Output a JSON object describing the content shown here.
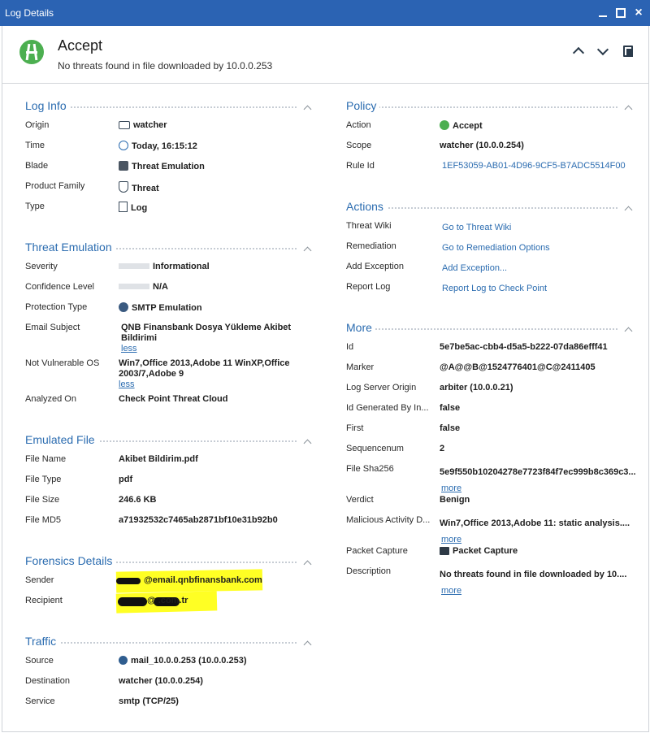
{
  "window": {
    "title": "Log Details",
    "close_glyph": "×",
    "controls": [
      "minimize-icon",
      "maximize-icon",
      "close-icon"
    ]
  },
  "header": {
    "title": "Accept",
    "subtitle": "No threats found in file downloaded by 10.0.0.253",
    "accent": "#4caf50"
  },
  "log_info": {
    "title": "Log Info",
    "rows": [
      {
        "label": "Origin",
        "value": "watcher",
        "icon": "watcher-icon"
      },
      {
        "label": "Time",
        "value": "Today, 16:15:12",
        "icon": "clock-icon"
      },
      {
        "label": "Blade",
        "value": "Threat Emulation",
        "icon": "blade-icon"
      },
      {
        "label": "Product Family",
        "value": "Threat",
        "icon": "shield-icon"
      },
      {
        "label": "Type",
        "value": "Log",
        "icon": "log-icon"
      }
    ]
  },
  "threat_emulation": {
    "title": "Threat Emulation",
    "severity_label": "Severity",
    "severity": "Informational",
    "confidence_label": "Confidence Level",
    "confidence": "N/A",
    "protection_label": "Protection Type",
    "protection": "SMTP Emulation",
    "subject_label": "Email Subject",
    "subject": "QNB Finansbank Dosya Yükleme Akibet Bildirimi",
    "less": "less",
    "os_label": "Not Vulnerable OS",
    "os": "Win7,Office 2013,Adobe 11 WinXP,Office 2003/7,Adobe 9",
    "analyzed_label": "Analyzed On",
    "analyzed": "Check Point Threat Cloud"
  },
  "emulated_file": {
    "title": "Emulated File",
    "rows": [
      {
        "label": "File Name",
        "value": "Akibet Bildirim.pdf"
      },
      {
        "label": "File Type",
        "value": "pdf"
      },
      {
        "label": "File Size",
        "value": "246.6 KB"
      },
      {
        "label": "File MD5",
        "value": "a71932532c7465ab2871bf10e31b92b0"
      }
    ]
  },
  "forensics": {
    "title": "Forensics Details",
    "sender_label": "Sender",
    "sender": "@email.qnbfinansbank.com",
    "recipient_label": "Recipient",
    "recipient": "@ .com.tr",
    "highlight": "#ffff24"
  },
  "traffic": {
    "title": "Traffic",
    "source_label": "Source",
    "source": "mail_10.0.0.253 (10.0.0.253)",
    "destination_label": "Destination",
    "destination": "watcher (10.0.0.254)",
    "service_label": "Service",
    "service": "smtp (TCP/25)"
  },
  "policy": {
    "title": "Policy",
    "action_label": "Action",
    "action": "Accept",
    "scope_label": "Scope",
    "scope": "watcher (10.0.0.254)",
    "rule_label": "Rule Id",
    "rule": "1EF53059-AB01-4D96-9CF5-B7ADC5514F00"
  },
  "actions": {
    "title": "Actions",
    "rows": [
      {
        "label": "Threat Wiki",
        "link": "Go to Threat Wiki"
      },
      {
        "label": "Remediation",
        "link": "Go to Remediation Options"
      },
      {
        "label": "Add Exception",
        "link": "Add Exception..."
      },
      {
        "label": "Report Log",
        "link": "Report Log to Check Point"
      }
    ]
  },
  "more": {
    "title": "More",
    "id_label": "Id",
    "id": "5e7be5ac-cbb4-d5a5-b222-07da86efff41",
    "marker_label": "Marker",
    "marker": "@A@@B@1524776401@C@2411405",
    "server_label": "Log Server Origin",
    "server": "arbiter (10.0.0.21)",
    "generated_label": "Id Generated By In...",
    "generated": "false",
    "first_label": "First",
    "first": "false",
    "seq_label": "Sequencenum",
    "seq": "2",
    "sha_label": "File Sha256",
    "sha": "5e9f550b10204278e7723f84f7ec999b8c369c3...",
    "more_link": "more",
    "verdict_label": "Verdict",
    "verdict": "Benign",
    "malicious_label": "Malicious Activity D...",
    "malicious": "Win7,Office 2013,Adobe 11: static analysis....",
    "packet_label": "Packet Capture",
    "packet": "Packet Capture",
    "desc_label": "Description",
    "desc": "No threats found in file downloaded by 10...."
  }
}
